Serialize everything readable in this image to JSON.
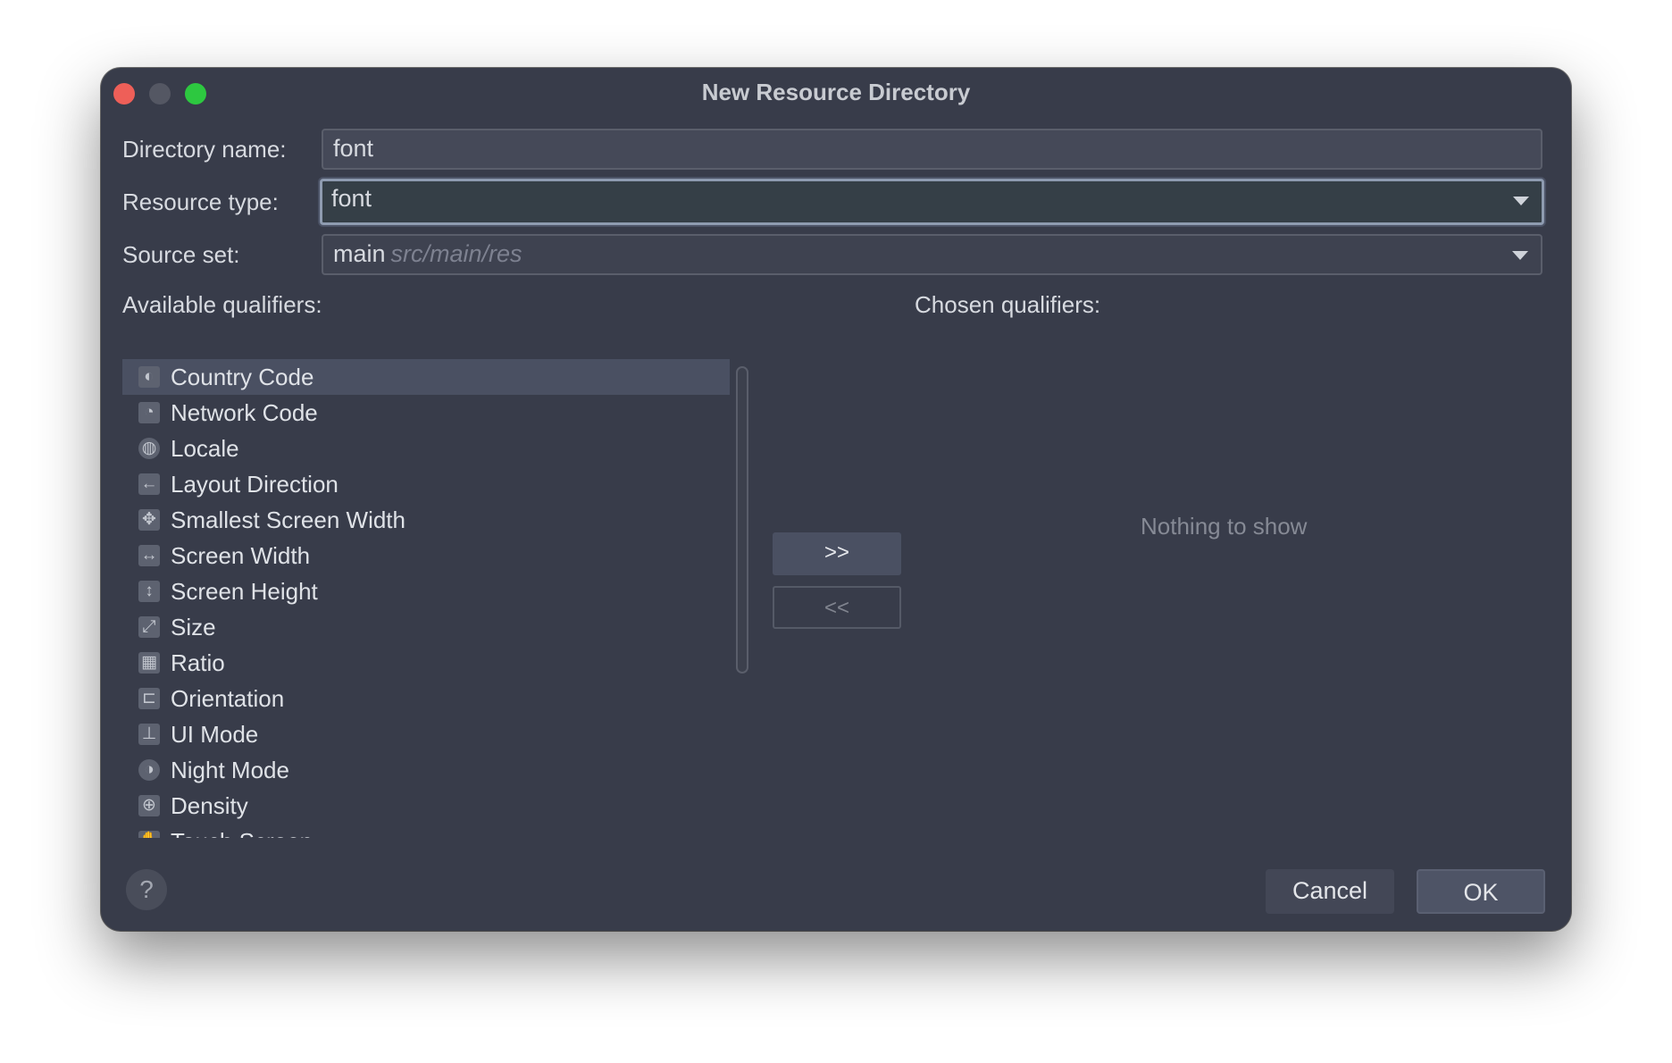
{
  "window": {
    "title": "New Resource Directory"
  },
  "form": {
    "directory_name": {
      "label": "Directory name:",
      "value": "font"
    },
    "resource_type": {
      "label": "Resource type:",
      "value": "font"
    },
    "source_set": {
      "label": "Source set:",
      "value": "main",
      "path": "src/main/res"
    }
  },
  "qualifiers": {
    "available_label": "Available qualifiers:",
    "chosen_label": "Chosen qualifiers:",
    "available": [
      {
        "label": "Country Code",
        "icon": "country-code-icon",
        "glyph": "◐",
        "selected": true
      },
      {
        "label": "Network Code",
        "icon": "network-code-icon",
        "glyph": "◔",
        "selected": false
      },
      {
        "label": "Locale",
        "icon": "globe-icon",
        "glyph": "◍",
        "selected": false
      },
      {
        "label": "Layout Direction",
        "icon": "layout-direction-icon",
        "glyph": "←",
        "selected": false
      },
      {
        "label": "Smallest Screen Width",
        "icon": "smallest-screen-width-icon",
        "glyph": "✥",
        "selected": false
      },
      {
        "label": "Screen Width",
        "icon": "screen-width-icon",
        "glyph": "↔",
        "selected": false
      },
      {
        "label": "Screen Height",
        "icon": "screen-height-icon",
        "glyph": "↕",
        "selected": false
      },
      {
        "label": "Size",
        "icon": "size-icon",
        "glyph": "⤢",
        "selected": false
      },
      {
        "label": "Ratio",
        "icon": "ratio-icon",
        "glyph": "▦",
        "selected": false
      },
      {
        "label": "Orientation",
        "icon": "orientation-icon",
        "glyph": "⊏",
        "selected": false
      },
      {
        "label": "UI Mode",
        "icon": "ui-mode-icon",
        "glyph": "⊥",
        "selected": false
      },
      {
        "label": "Night Mode",
        "icon": "night-mode-icon",
        "glyph": "◑",
        "selected": false
      },
      {
        "label": "Density",
        "icon": "density-icon",
        "glyph": "⊕",
        "selected": false
      },
      {
        "label": "Touch Screen",
        "icon": "touch-screen-icon",
        "glyph": "✋",
        "selected": false
      }
    ],
    "chosen_empty_text": "Nothing to show"
  },
  "buttons": {
    "add": ">>",
    "remove": "<<",
    "help": "?",
    "cancel": "Cancel",
    "ok": "OK"
  }
}
